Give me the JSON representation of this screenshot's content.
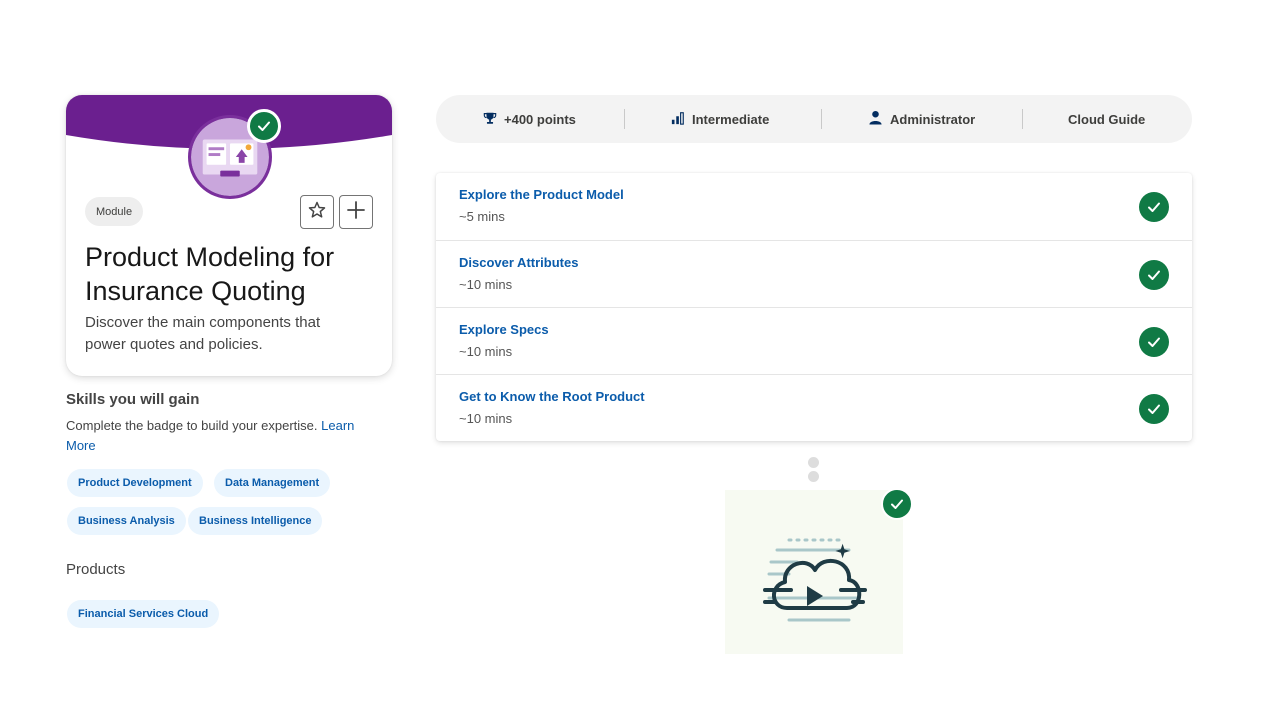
{
  "module": {
    "tag": "Module",
    "title": "Product Modeling for Insurance Quoting",
    "description": "Discover the main components that power quotes and policies.",
    "banner_color": "#6b1f8f",
    "completed_icon": "check-icon",
    "favorite_icon": "star-outline-icon",
    "add_icon": "plus-icon"
  },
  "skills": {
    "heading": "Skills you will gain",
    "description": "Complete the badge to build your expertise.",
    "learn_more": "Learn More",
    "chips": [
      "Product Development",
      "Data Management",
      "Business Analysis",
      "Business Intelligence"
    ]
  },
  "products": {
    "heading": "Products",
    "chips": [
      "Financial Services Cloud"
    ]
  },
  "stats": {
    "points": "+400 points",
    "level": "Intermediate",
    "role": "Administrator",
    "product": "Cloud Guide",
    "icons": [
      "trophy-icon",
      "bar-chart-icon",
      "person-icon"
    ]
  },
  "units": [
    {
      "title": "Explore the Product Model",
      "time": "~5 mins",
      "completed": true
    },
    {
      "title": "Discover Attributes",
      "time": "~10 mins",
      "completed": true
    },
    {
      "title": "Explore Specs",
      "time": "~10 mins",
      "completed": true
    },
    {
      "title": "Get to Know the Root Product",
      "time": "~10 mins",
      "completed": true
    }
  ],
  "colors": {
    "brand_purple": "#6b1f8f",
    "success_green": "#107a45",
    "link_blue": "#0b5cab",
    "chip_bg": "#eaf5fe"
  }
}
